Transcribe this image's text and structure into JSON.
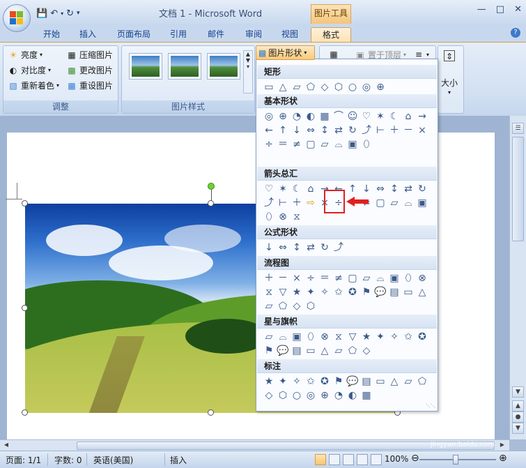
{
  "window": {
    "title": "文档 1 - Microsoft Word",
    "context_tab_group": "图片工具",
    "qat": [
      "save-icon",
      "undo-icon",
      "redo-icon",
      "customize-icon"
    ]
  },
  "tabs": [
    {
      "label": "开始"
    },
    {
      "label": "插入"
    },
    {
      "label": "页面布局"
    },
    {
      "label": "引用"
    },
    {
      "label": "邮件"
    },
    {
      "label": "审阅"
    },
    {
      "label": "视图"
    },
    {
      "label": "格式",
      "active": true
    }
  ],
  "ribbon": {
    "adjust": {
      "label": "调整",
      "brightness": "亮度",
      "contrast": "对比度",
      "recolor": "重新着色",
      "compress": "压缩图片",
      "change_picture": "更改图片",
      "reset_picture": "重设图片"
    },
    "picture_styles": {
      "label": "图片样式"
    },
    "picture_shape": "图片形状",
    "bring_to_front": "置于顶层",
    "size_label": "大小"
  },
  "shapes_panel": {
    "categories": [
      {
        "title": "矩形",
        "count": 9
      },
      {
        "title": "基本形状",
        "count": 32
      },
      {
        "title": "箭头总汇",
        "count": 27
      },
      {
        "title": "公式形状",
        "count": 6
      },
      {
        "title": "流程图",
        "count": 28
      },
      {
        "title": "星与旗帜",
        "count": 20
      },
      {
        "title": "标注",
        "count": 20
      }
    ],
    "highlighted_shape": "striped-right-arrow"
  },
  "statusbar": {
    "page": "页面: 1/1",
    "words": "字数: 0",
    "language": "英语(美国)",
    "mode": "插入",
    "zoom": "100%"
  },
  "watermark": {
    "text": "Baidu 经验",
    "sub": "jingyan.baidu.com"
  },
  "colors": {
    "accent_orange": "#f9c97a",
    "highlight_red": "#e02020",
    "ribbon_blue": "#d2e0f2"
  }
}
